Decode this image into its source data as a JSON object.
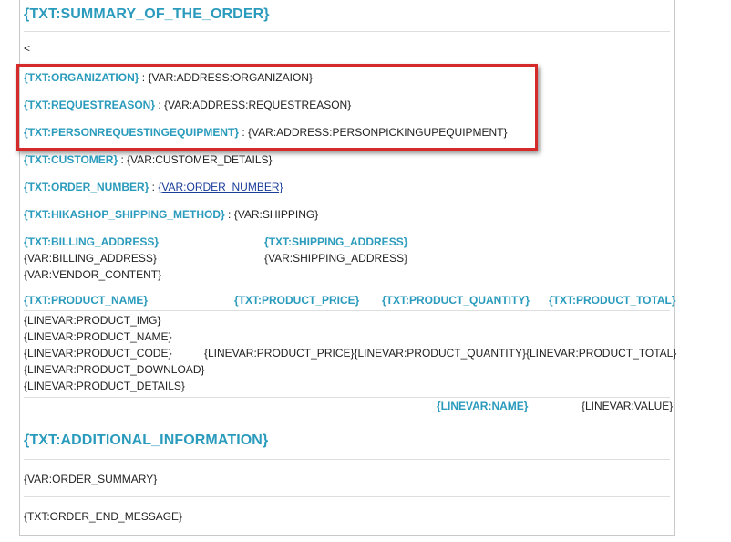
{
  "summary_heading": "{TXT:SUMMARY_OF_THE_ORDER}",
  "stray_char": "<",
  "highlighted_fields": [
    {
      "label": "{TXT:ORGANIZATION}",
      "sep": " : ",
      "value": "{VAR:ADDRESS:ORGANIZAION}"
    },
    {
      "label": "{TXT:REQUESTREASON}",
      "sep": " : ",
      "value": "{VAR:ADDRESS:REQUESTREASON}"
    },
    {
      "label": "{TXT:PERSONREQUESTINGEQUIPMENT}",
      "sep": " : ",
      "value": "{VAR:ADDRESS:PERSONPICKINGUPEQUIPMENT}"
    }
  ],
  "customer": {
    "label": "{TXT:CUSTOMER}",
    "sep": " : ",
    "value": "{VAR:CUSTOMER_DETAILS}"
  },
  "order_number": {
    "label": "{TXT:ORDER_NUMBER}",
    "sep": " : ",
    "value": "{VAR:ORDER_NUMBER}"
  },
  "shipping_method": {
    "label": "{TXT:HIKASHOP_SHIPPING_METHOD}",
    "sep": " : ",
    "value": "{VAR:SHIPPING}"
  },
  "billing": {
    "label": "{TXT:BILLING_ADDRESS}",
    "value": "{VAR:BILLING_ADDRESS}"
  },
  "shipping_address": {
    "label": "{TXT:SHIPPING_ADDRESS}",
    "value": "{VAR:SHIPPING_ADDRESS}"
  },
  "vendor_content": "{VAR:VENDOR_CONTENT}",
  "product_table": {
    "headers": [
      "{TXT:PRODUCT_NAME}",
      "{TXT:PRODUCT_PRICE}",
      "{TXT:PRODUCT_QUANTITY}",
      "{TXT:PRODUCT_TOTAL}"
    ],
    "line_lines": [
      "{LINEVAR:PRODUCT_IMG}",
      "{LINEVAR:PRODUCT_NAME}",
      "{LINEVAR:PRODUCT_CODE}",
      "{LINEVAR:PRODUCT_DOWNLOAD}",
      "{LINEVAR:PRODUCT_DETAILS}"
    ],
    "price": "{LINEVAR:PRODUCT_PRICE}",
    "quantity": "{LINEVAR:PRODUCT_QUANTITY}",
    "total": "{LINEVAR:PRODUCT_TOTAL}"
  },
  "totals_row": {
    "name": "{LINEVAR:NAME}",
    "value": "{LINEVAR:VALUE}"
  },
  "additional_heading": "{TXT:ADDITIONAL_INFORMATION}",
  "order_summary": "{VAR:ORDER_SUMMARY}",
  "order_end_message": "{TXT:ORDER_END_MESSAGE}",
  "colors": {
    "label_blue": "#2a9bbc",
    "link_blue": "#1a3d9a",
    "highlight_red": "#d42a2a"
  }
}
